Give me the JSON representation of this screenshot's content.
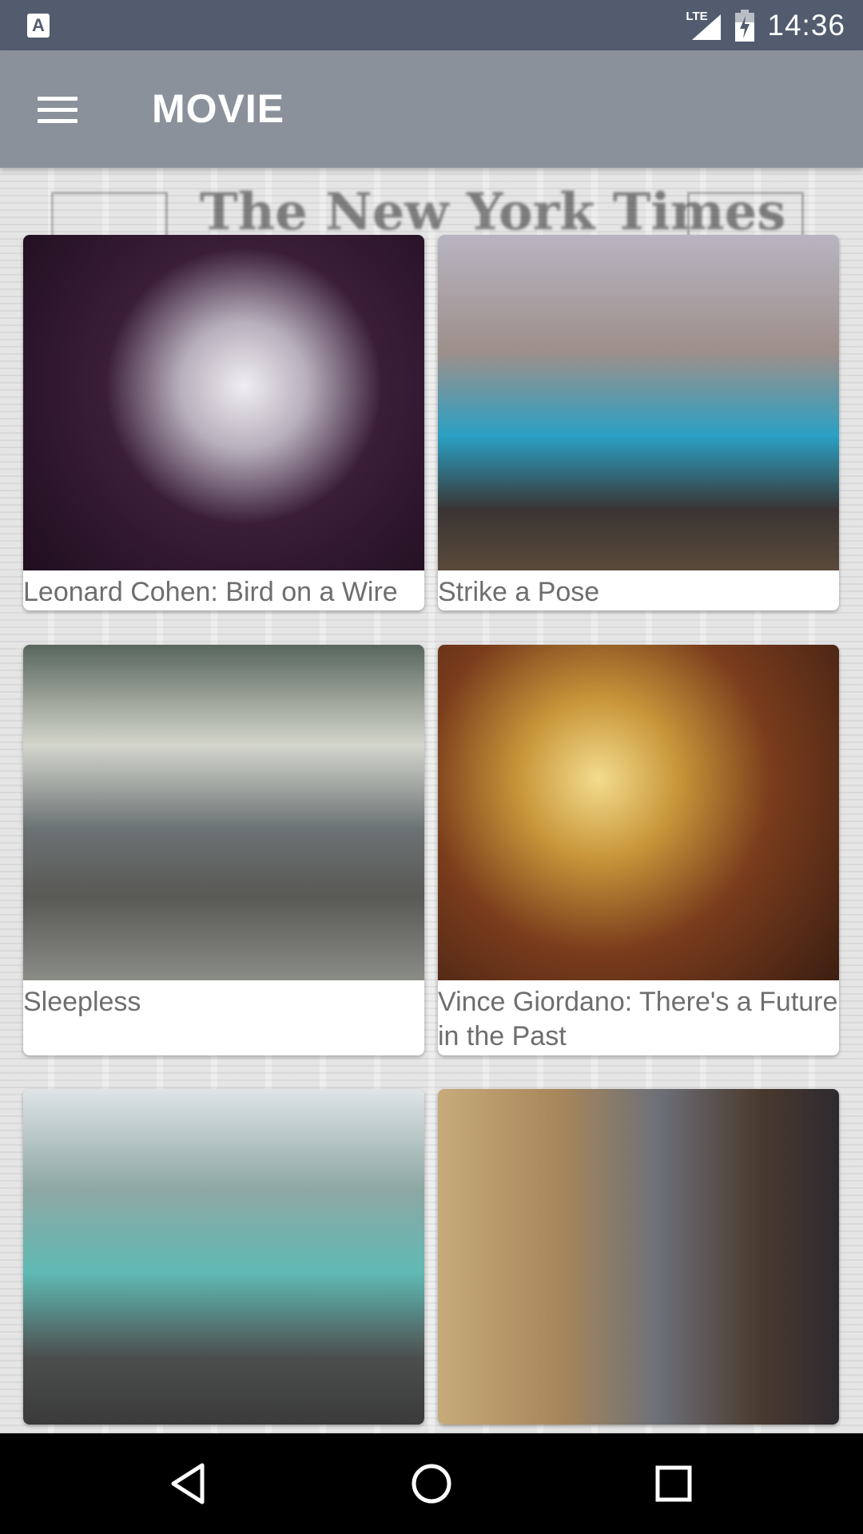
{
  "status_bar": {
    "left_icon": "A",
    "lte_label": "LTE",
    "time": "14:36",
    "icons": [
      "notification-a-icon",
      "lte-signal-icon",
      "battery-icon"
    ]
  },
  "app_bar": {
    "title": "MOVIE",
    "menu_icon": "hamburger-menu-icon"
  },
  "background": {
    "masthead_text": "The New York Times"
  },
  "movies": [
    {
      "title": "Leonard Cohen: Bird on a Wire"
    },
    {
      "title": "Strike a Pose"
    },
    {
      "title": "Sleepless"
    },
    {
      "title": "Vince Giordano: There's a Future in the Past"
    },
    {
      "title": ""
    },
    {
      "title": ""
    }
  ],
  "nav_bar": {
    "icons": [
      "back-icon",
      "home-icon",
      "recents-icon"
    ]
  },
  "colors": {
    "status_bar": "#525c6e",
    "app_bar": "#8b919b",
    "title_text": "#6e6e6e"
  }
}
